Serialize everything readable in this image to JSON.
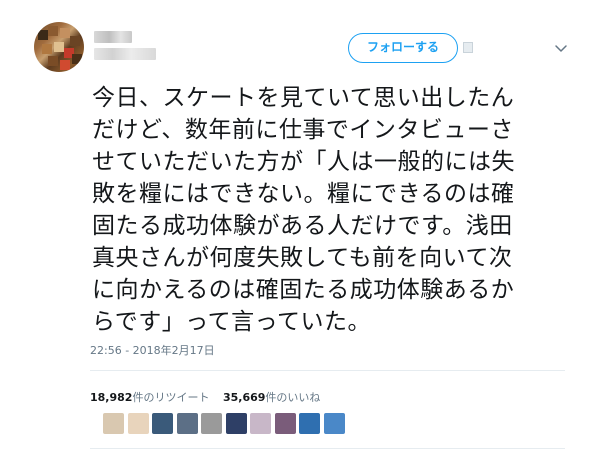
{
  "tweet": {
    "follow_label": "フォローする",
    "text_lines": [
      "今日、スケートを見ていて思い出したん",
      "だけど、数年前に仕事でインタビューさ",
      "せていただいた方が「人は一般的には失",
      "敗を糧にはできない。糧にできるのは確",
      "固たる成功体験がある人だけです。浅田",
      "真央さんが何度失敗しても前を向いて次",
      "に向かえるのは確固たる成功体験あるか",
      "らです」って言っていた。"
    ],
    "timestamp": "22:56 - 2018年2月17日",
    "retweets": {
      "count": "18,982",
      "label": "件のリツイート"
    },
    "likes": {
      "count": "35,669",
      "label": "件のいいね"
    },
    "liker_colors": [
      "#d9c8b0",
      "#e8d4bc",
      "#3a5a7a",
      "#5c6f86",
      "#9a9a9a",
      "#2e3f66",
      "#c8b7c8",
      "#7a5c7a",
      "#2f6fb0",
      "#4a88c8"
    ],
    "colors": {
      "accent": "#1da1f2",
      "text": "#14171a",
      "secondary": "#657786"
    }
  }
}
